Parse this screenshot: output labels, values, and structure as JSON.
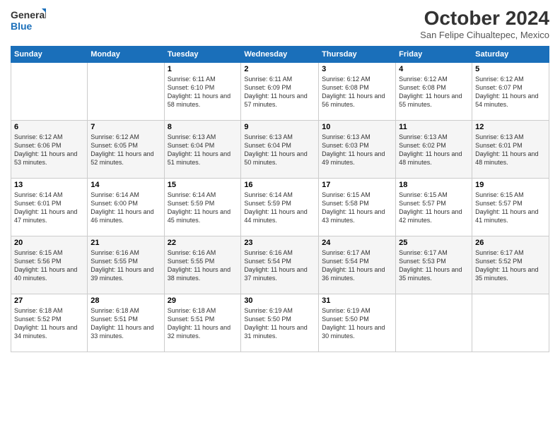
{
  "logo": {
    "line1": "General",
    "line2": "Blue"
  },
  "title": "October 2024",
  "location": "San Felipe Cihualtepec, Mexico",
  "days_of_week": [
    "Sunday",
    "Monday",
    "Tuesday",
    "Wednesday",
    "Thursday",
    "Friday",
    "Saturday"
  ],
  "weeks": [
    [
      {
        "day": null
      },
      {
        "day": null
      },
      {
        "day": 1,
        "sunrise": "6:11 AM",
        "sunset": "6:10 PM",
        "daylight": "11 hours and 58 minutes."
      },
      {
        "day": 2,
        "sunrise": "6:11 AM",
        "sunset": "6:09 PM",
        "daylight": "11 hours and 57 minutes."
      },
      {
        "day": 3,
        "sunrise": "6:12 AM",
        "sunset": "6:08 PM",
        "daylight": "11 hours and 56 minutes."
      },
      {
        "day": 4,
        "sunrise": "6:12 AM",
        "sunset": "6:08 PM",
        "daylight": "11 hours and 55 minutes."
      },
      {
        "day": 5,
        "sunrise": "6:12 AM",
        "sunset": "6:07 PM",
        "daylight": "11 hours and 54 minutes."
      }
    ],
    [
      {
        "day": 6,
        "sunrise": "6:12 AM",
        "sunset": "6:06 PM",
        "daylight": "11 hours and 53 minutes."
      },
      {
        "day": 7,
        "sunrise": "6:12 AM",
        "sunset": "6:05 PM",
        "daylight": "11 hours and 52 minutes."
      },
      {
        "day": 8,
        "sunrise": "6:13 AM",
        "sunset": "6:04 PM",
        "daylight": "11 hours and 51 minutes."
      },
      {
        "day": 9,
        "sunrise": "6:13 AM",
        "sunset": "6:04 PM",
        "daylight": "11 hours and 50 minutes."
      },
      {
        "day": 10,
        "sunrise": "6:13 AM",
        "sunset": "6:03 PM",
        "daylight": "11 hours and 49 minutes."
      },
      {
        "day": 11,
        "sunrise": "6:13 AM",
        "sunset": "6:02 PM",
        "daylight": "11 hours and 48 minutes."
      },
      {
        "day": 12,
        "sunrise": "6:13 AM",
        "sunset": "6:01 PM",
        "daylight": "11 hours and 48 minutes."
      }
    ],
    [
      {
        "day": 13,
        "sunrise": "6:14 AM",
        "sunset": "6:01 PM",
        "daylight": "11 hours and 47 minutes."
      },
      {
        "day": 14,
        "sunrise": "6:14 AM",
        "sunset": "6:00 PM",
        "daylight": "11 hours and 46 minutes."
      },
      {
        "day": 15,
        "sunrise": "6:14 AM",
        "sunset": "5:59 PM",
        "daylight": "11 hours and 45 minutes."
      },
      {
        "day": 16,
        "sunrise": "6:14 AM",
        "sunset": "5:59 PM",
        "daylight": "11 hours and 44 minutes."
      },
      {
        "day": 17,
        "sunrise": "6:15 AM",
        "sunset": "5:58 PM",
        "daylight": "11 hours and 43 minutes."
      },
      {
        "day": 18,
        "sunrise": "6:15 AM",
        "sunset": "5:57 PM",
        "daylight": "11 hours and 42 minutes."
      },
      {
        "day": 19,
        "sunrise": "6:15 AM",
        "sunset": "5:57 PM",
        "daylight": "11 hours and 41 minutes."
      }
    ],
    [
      {
        "day": 20,
        "sunrise": "6:15 AM",
        "sunset": "5:56 PM",
        "daylight": "11 hours and 40 minutes."
      },
      {
        "day": 21,
        "sunrise": "6:16 AM",
        "sunset": "5:55 PM",
        "daylight": "11 hours and 39 minutes."
      },
      {
        "day": 22,
        "sunrise": "6:16 AM",
        "sunset": "5:55 PM",
        "daylight": "11 hours and 38 minutes."
      },
      {
        "day": 23,
        "sunrise": "6:16 AM",
        "sunset": "5:54 PM",
        "daylight": "11 hours and 37 minutes."
      },
      {
        "day": 24,
        "sunrise": "6:17 AM",
        "sunset": "5:54 PM",
        "daylight": "11 hours and 36 minutes."
      },
      {
        "day": 25,
        "sunrise": "6:17 AM",
        "sunset": "5:53 PM",
        "daylight": "11 hours and 35 minutes."
      },
      {
        "day": 26,
        "sunrise": "6:17 AM",
        "sunset": "5:52 PM",
        "daylight": "11 hours and 35 minutes."
      }
    ],
    [
      {
        "day": 27,
        "sunrise": "6:18 AM",
        "sunset": "5:52 PM",
        "daylight": "11 hours and 34 minutes."
      },
      {
        "day": 28,
        "sunrise": "6:18 AM",
        "sunset": "5:51 PM",
        "daylight": "11 hours and 33 minutes."
      },
      {
        "day": 29,
        "sunrise": "6:18 AM",
        "sunset": "5:51 PM",
        "daylight": "11 hours and 32 minutes."
      },
      {
        "day": 30,
        "sunrise": "6:19 AM",
        "sunset": "5:50 PM",
        "daylight": "11 hours and 31 minutes."
      },
      {
        "day": 31,
        "sunrise": "6:19 AM",
        "sunset": "5:50 PM",
        "daylight": "11 hours and 30 minutes."
      },
      {
        "day": null
      },
      {
        "day": null
      }
    ]
  ],
  "labels": {
    "sunrise": "Sunrise: ",
    "sunset": "Sunset: ",
    "daylight": "Daylight: "
  }
}
